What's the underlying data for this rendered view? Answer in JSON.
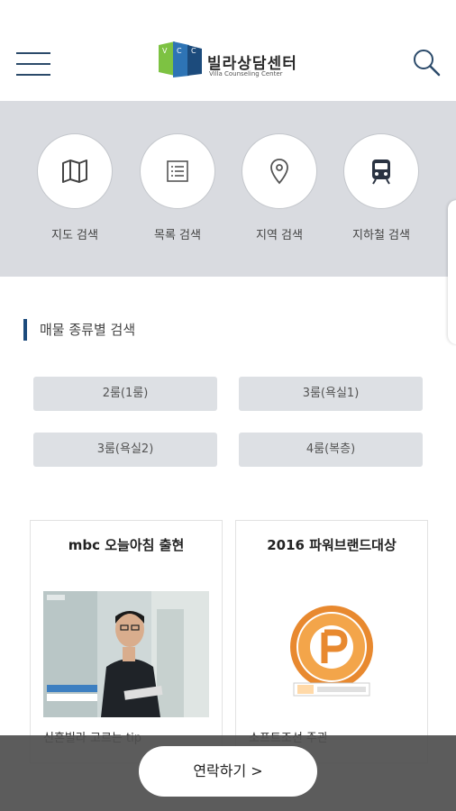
{
  "header": {
    "menu_icon": "hamburger-icon",
    "logo": {
      "name": "빌라상담센터",
      "subtitle": "Villa Counseling Center",
      "mark": "VCC",
      "colors": [
        "#7dc242",
        "#2e74b5",
        "#1c4b7c"
      ]
    },
    "search_icon": "search-icon"
  },
  "quick_menu": [
    {
      "label": "지도 검색",
      "icon": "map-icon"
    },
    {
      "label": "목록 검색",
      "icon": "list-icon"
    },
    {
      "label": "지역 검색",
      "icon": "location-pin-icon"
    },
    {
      "label": "지하철 검색",
      "icon": "subway-icon"
    }
  ],
  "section": {
    "title": "매물 종류별 검색"
  },
  "room_types": [
    "2룸(1룸)",
    "3룸(욕실1)",
    "3룸(욕실2)",
    "4룸(복층)"
  ],
  "cards": [
    {
      "title": "mbc 오늘아침 출현",
      "caption": "신혼빌라 고르는 tip"
    },
    {
      "title": "2016 파워브랜드대상",
      "caption": "소프트조선 주관"
    }
  ],
  "bottom": {
    "contact_label": "연락하기 >"
  },
  "colors": {
    "accent": "#1c4b7c",
    "panel_bg": "#d9dbe0",
    "button_bg": "#dde0e4",
    "bottom_bar": "#505050"
  }
}
